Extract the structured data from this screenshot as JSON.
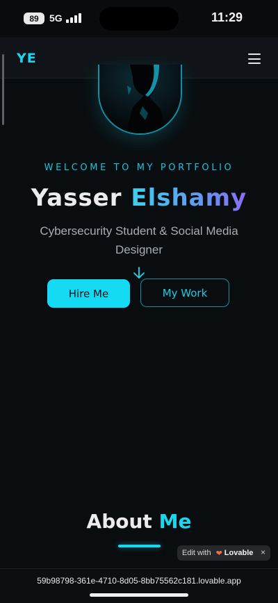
{
  "status_bar": {
    "battery": "89",
    "network": "5G",
    "time": "11:29"
  },
  "header": {
    "logo": "YE"
  },
  "hero": {
    "welcome": "WELCOME TO MY PORTFOLIO",
    "first_name": "Yasser",
    "last_name": "Elshamy",
    "tagline": "Cybersecurity Student & Social Media Designer",
    "hire_button": "Hire Me",
    "work_button": "My Work"
  },
  "about": {
    "title_part1": "About",
    "title_part2": "Me"
  },
  "badge": {
    "prefix": "Edit with",
    "brand": "Lovable",
    "close": "×"
  },
  "browser": {
    "url": "59b98798-361e-4710-8d05-8bb75562c181.lovable.app"
  },
  "colors": {
    "accent": "#17d8ef",
    "background": "#0a0d10",
    "gradient_end": "#8a6cf3"
  }
}
